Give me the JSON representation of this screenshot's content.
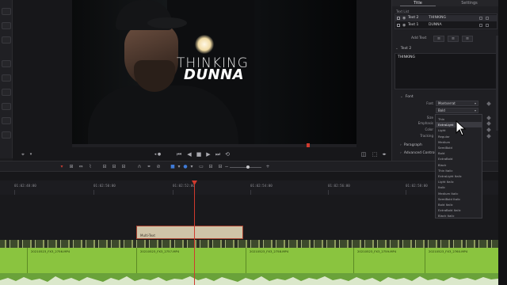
{
  "inspector": {
    "tabs": [
      "Title",
      "Settings"
    ],
    "text_list_label": "Text List",
    "text_list": [
      {
        "name": "Text 2",
        "value": "THINKING"
      },
      {
        "name": "Text 1",
        "value": "DUNNA"
      }
    ],
    "add_text": "Add Text",
    "section_text": "Text 2",
    "content": "THINKING",
    "section_font": "Font",
    "font_label": "Font",
    "font_value": "Montserrat",
    "style_value": "Bold",
    "size_label": "Size",
    "emphasis_label": "Emphasis",
    "color_label": "Color",
    "tracking_label": "Tracking",
    "section_paragraph": "Paragraph",
    "section_advanced": "Advanced Controls"
  },
  "dropdown": {
    "items": [
      "Thin",
      "ExtraLight",
      "Light",
      "Regular",
      "Medium",
      "SemiBold",
      "Bold",
      "ExtraBold",
      "Black",
      "Thin Italic",
      "ExtraLight Italic",
      "Light Italic",
      "Italic",
      "Medium Italic",
      "SemiBold Italic",
      "Bold Italic",
      "ExtraBold Italic",
      "Black Italic"
    ],
    "highlighted": "ExtraLight"
  },
  "viewer": {
    "title_line1": "THINKING",
    "title_line2": "DUNNA"
  },
  "timeline": {
    "timecodes": [
      "01:02:48:00",
      "01:02:50:00",
      "01:02:52:00",
      "01:02:54:00",
      "01:02:56:00",
      "01:02:58:00"
    ],
    "title_clip": "Multi-Text",
    "clips": [
      "20210523_FX3_2756.MP4",
      "20210523_FX3_2757.MP4",
      "20210523_FX3_2758.MP4",
      "20210523_FX3_2759.MP4",
      "20210523_FX3_2760.MP4"
    ]
  },
  "colors": {
    "playhead": "#d03a2e",
    "video_track": "#8ac43f",
    "audio_track": "#6aa23a",
    "title_clip": "#cfc4a8"
  }
}
